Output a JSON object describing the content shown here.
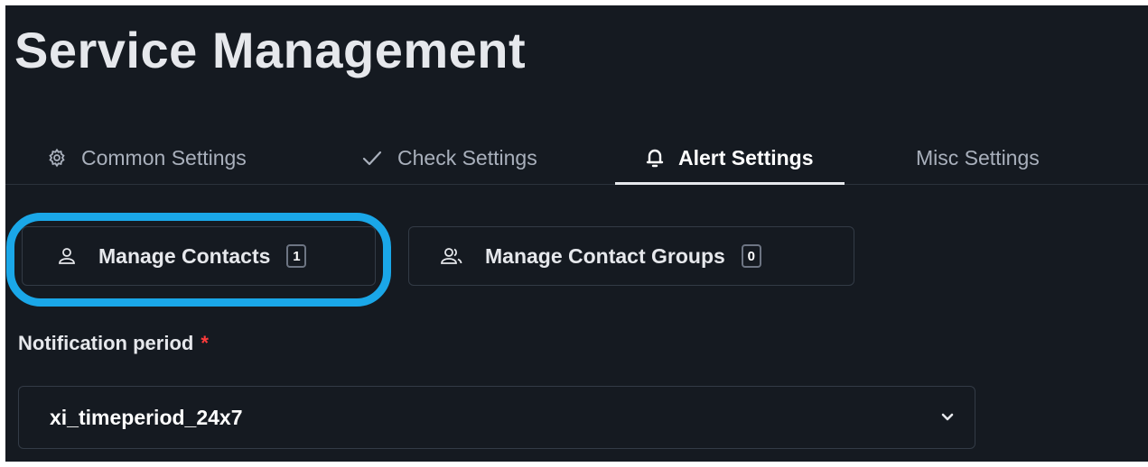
{
  "page": {
    "title": "Service Management"
  },
  "tabs": [
    {
      "label": "Common Settings",
      "icon": "gear-icon",
      "active": false
    },
    {
      "label": "Check Settings",
      "icon": "check-icon",
      "active": false
    },
    {
      "label": "Alert Settings",
      "icon": "bell-icon",
      "active": true
    },
    {
      "label": "Misc Settings",
      "icon": "",
      "active": false
    }
  ],
  "contacts": {
    "manage_contacts_label": "Manage Contacts",
    "manage_contacts_count": "1",
    "manage_groups_label": "Manage Contact Groups",
    "manage_groups_count": "0",
    "highlighted": "manage-contacts"
  },
  "notification": {
    "label": "Notification period",
    "required_marker": "*",
    "selected_value": "xi_timeperiod_24x7"
  },
  "colors": {
    "background": "#151a21",
    "highlight": "#1aa7e8",
    "required": "#ff3b3b",
    "text": "#e6e8ec"
  }
}
